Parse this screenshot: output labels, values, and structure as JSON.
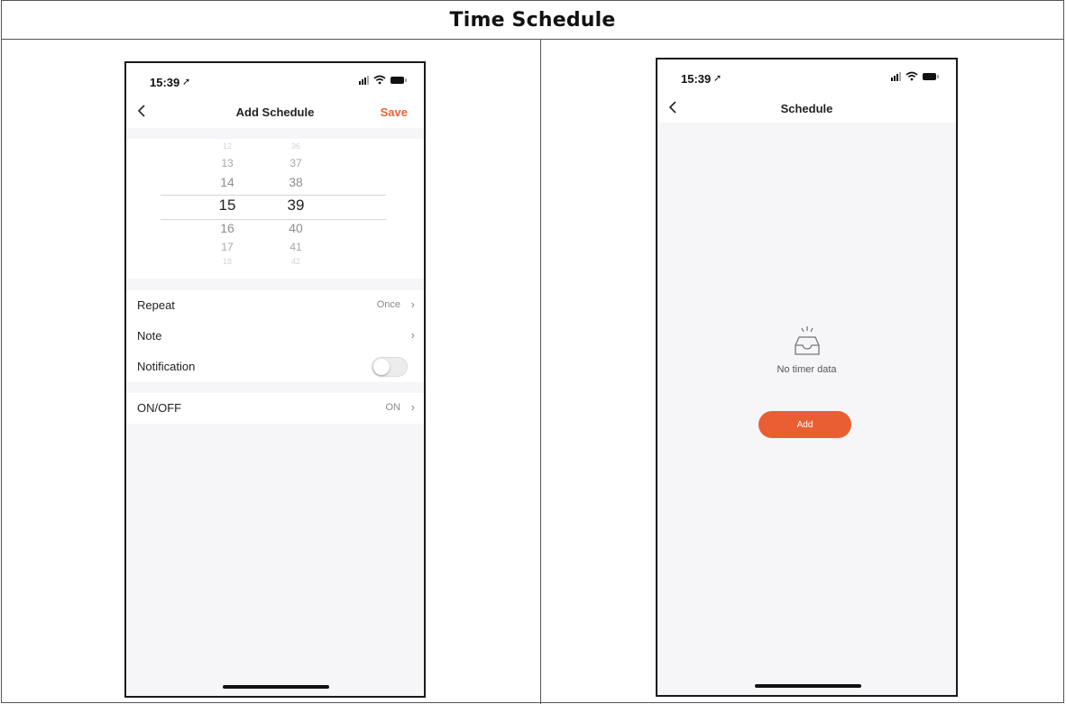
{
  "document": {
    "title": "Time Schedule"
  },
  "left_phone": {
    "status": {
      "time": "15:39",
      "location_glyph": "➚"
    },
    "nav": {
      "back_glyph": "‹",
      "title": "Add Schedule",
      "save_label": "Save"
    },
    "picker": {
      "hours": [
        "12",
        "13",
        "14",
        "15",
        "16",
        "17",
        "18"
      ],
      "minutes": [
        "36",
        "37",
        "38",
        "39",
        "40",
        "41",
        "42"
      ],
      "selected_hour": "15",
      "selected_minute": "39"
    },
    "settings": {
      "repeat_label": "Repeat",
      "repeat_value": "Once",
      "note_label": "Note",
      "notification_label": "Notification",
      "notification_on": false,
      "onoff_label": "ON/OFF",
      "onoff_value": "ON",
      "chevron": "›"
    }
  },
  "right_phone": {
    "status": {
      "time": "15:39",
      "location_glyph": "➚"
    },
    "nav": {
      "back_glyph": "‹",
      "title": "Schedule"
    },
    "empty_state": {
      "icon": "empty-inbox-icon",
      "message": "No timer data",
      "add_label": "Add"
    }
  },
  "colors": {
    "accent": "#e95f33",
    "save_text": "#e8623a",
    "screen_bg": "#f6f6f8"
  }
}
